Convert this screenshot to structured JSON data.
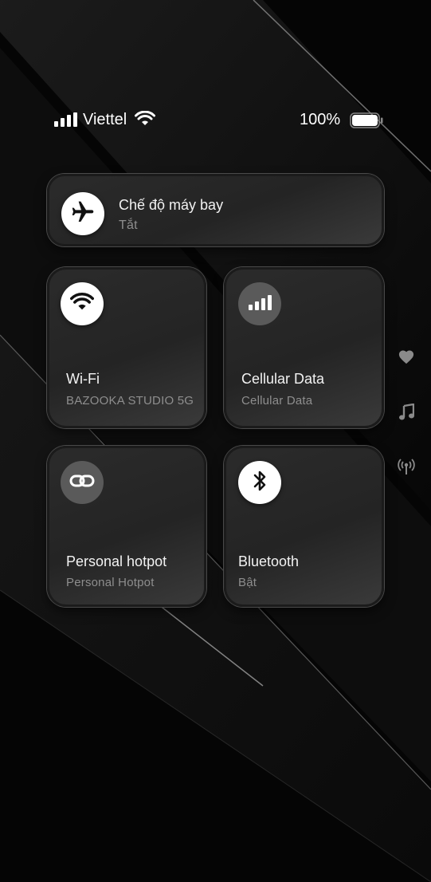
{
  "status_bar": {
    "carrier": "Viettel",
    "battery_percent": "100%",
    "signal_icon": "cellular-signal-icon",
    "wifi_icon": "wifi-icon",
    "battery_icon": "battery-icon"
  },
  "airplane_mode": {
    "title": "Chế độ máy bay",
    "status": "Tắt",
    "icon": "airplane-icon"
  },
  "tiles": {
    "wifi": {
      "title": "Wi-Fi",
      "subtitle": "BAZOOKA STUDIO 5G",
      "icon": "wifi-icon",
      "active": true
    },
    "cellular": {
      "title": "Cellular Data",
      "subtitle": "Cellular Data",
      "icon": "cellular-bars-icon",
      "active": false
    },
    "hotspot": {
      "title": "Personal hotpot",
      "subtitle": "Personal Hotpot",
      "icon": "link-icon",
      "active": false
    },
    "bluetooth": {
      "title": "Bluetooth",
      "subtitle": "Bật",
      "icon": "bluetooth-icon",
      "active": true
    }
  },
  "side_icons": [
    "heart-icon",
    "music-note-icon",
    "broadcast-icon"
  ],
  "colors": {
    "background": "#050505",
    "card": "#2a2a2a",
    "active_circle": "#ffffff",
    "inactive_circle": "#5a5a5a",
    "subtitle": "#8e8e8e"
  }
}
